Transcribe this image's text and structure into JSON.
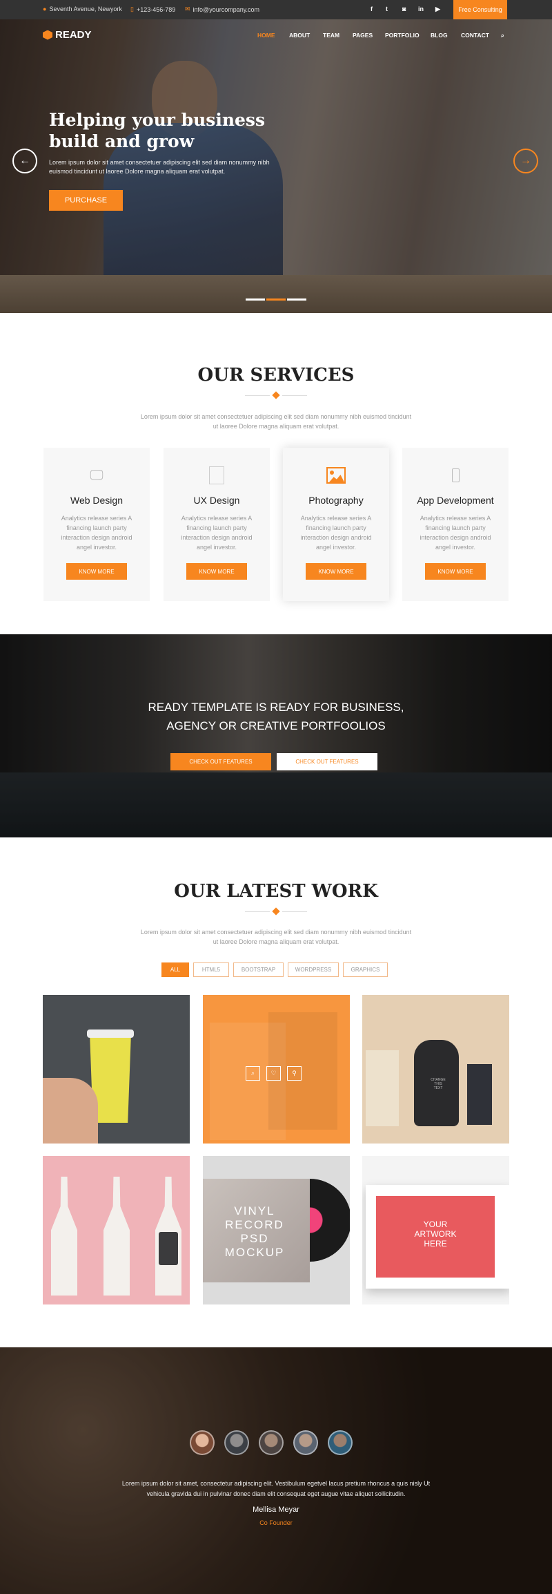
{
  "colors": {
    "accent": "#f7861f",
    "topbar": "#333333"
  },
  "topbar": {
    "address": "Seventh Avenue, Newyork",
    "phone": "+123-456-789",
    "email": "info@yourcompany.com",
    "social": [
      {
        "icon": "facebook-icon",
        "glyph": "f"
      },
      {
        "icon": "twitter-icon",
        "glyph": "t"
      },
      {
        "icon": "instagram-icon",
        "glyph": "◙"
      },
      {
        "icon": "linkedin-icon",
        "glyph": "in"
      },
      {
        "icon": "youtube-icon",
        "glyph": "▶"
      }
    ],
    "cta": "Free Consulting"
  },
  "header": {
    "logo": "READY",
    "nav": [
      "HOME",
      "ABOUT",
      "TEAM",
      "PAGES",
      "PORTFOLIO",
      "BLOG",
      "CONTACT"
    ],
    "active": "HOME"
  },
  "hero": {
    "title": "Helping your business build and grow",
    "text": "Lorem ipsum dolor sit amet consectetuer adipiscing elit sed diam nonummy nibh euismod tincidunt ut laoree Dolore magna aliquam erat volutpat.",
    "button": "PURCHASE",
    "slides": 3,
    "active_slide": 2
  },
  "services": {
    "title": "OUR SERVICES",
    "text": "Lorem ipsum dolor sit amet consectetuer adipiscing elit sed diam nonummy nibh euismod tincidunt ut laoree Dolore magna aliquam erat volutpat.",
    "items": [
      {
        "icon": "monitor-icon",
        "title": "Web Design",
        "text": "Analytics release series A financing launch party interaction design android angel investor.",
        "button": "KNOW MORE"
      },
      {
        "icon": "tablet-icon",
        "title": "UX Design",
        "text": "Analytics release series A financing launch party interaction design android angel investor.",
        "button": "KNOW MORE"
      },
      {
        "icon": "image-icon",
        "title": "Photography",
        "text": "Analytics release series A financing launch party interaction design android angel investor.",
        "button": "KNOW MORE"
      },
      {
        "icon": "phone-icon",
        "title": "App Development",
        "text": "Analytics release series A financing launch party interaction design android angel investor.",
        "button": "KNOW MORE"
      }
    ]
  },
  "cta": {
    "line1": "READY TEMPLATE IS READY FOR BUSINESS,",
    "line2": "AGENCY OR CREATIVE PORTFOOLIOS",
    "button1": "CHECK OUT FEATURES",
    "button2": "CHECK OUT FEATURES"
  },
  "work": {
    "title": "OUR LATEST WORK",
    "text": "Lorem ipsum dolor sit amet consectetuer adipiscing elit sed diam nonummy nibh euismod tincidunt ut laoree Dolore magna aliquam erat volutpat.",
    "filters": [
      "ALL",
      "HTML5",
      "BOOTSTRAP",
      "WORDPRESS",
      "GRAPHICS"
    ],
    "active_filter": "ALL",
    "tiles": [
      "Coffee cup mockup",
      "Shopping bags mockup",
      "Packaging mockup",
      "Ceramic bottles mockup",
      "Vinyl record mockup",
      "Artwork frame mockup"
    ],
    "tile_labels": {
      "vinyl": "VINYL RECORD PSD MOCKUP",
      "artwork": "YOUR ARTWORK HERE",
      "change": "CHANGE THIS TEXT"
    }
  },
  "testimonial": {
    "text": "Lorem ipsum dolor sit amet, consectetur adipiscing elit. Vestibulum egetvel lacus pretium rhoncus a quis nisly Ut vehicula gravida dui in pulvinar donec diam elit consequat eget augue vitae aliquet sollicitudin.",
    "name": "Mellisa Meyar",
    "role": "Co Founder",
    "avatars": 5
  }
}
